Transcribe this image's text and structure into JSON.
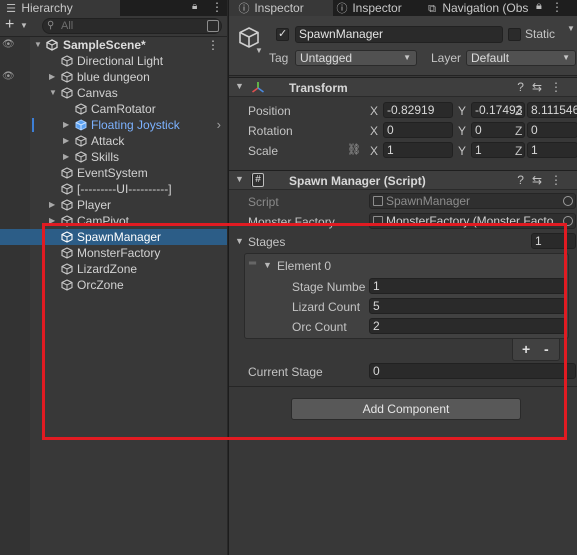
{
  "hierarchy": {
    "tab_label": "Hierarchy",
    "search_placeholder": "All",
    "scene_name": "SampleScene*",
    "items": [
      {
        "label": "Directional Light"
      },
      {
        "label": "blue dungeon"
      },
      {
        "label": "Canvas"
      },
      {
        "label": "CamRotator"
      },
      {
        "label": "Floating Joystick"
      },
      {
        "label": "Attack"
      },
      {
        "label": "Skills"
      },
      {
        "label": "EventSystem"
      },
      {
        "label": "[---------UI----------]"
      },
      {
        "label": "Player"
      },
      {
        "label": "CamPivot"
      },
      {
        "label": "SpawnManager"
      },
      {
        "label": "MonsterFactory"
      },
      {
        "label": "LizardZone"
      },
      {
        "label": "OrcZone"
      }
    ]
  },
  "inspector": {
    "tabs": [
      {
        "label": "Inspector",
        "icon": "info-icon"
      },
      {
        "label": "Inspector",
        "icon": "info-icon"
      },
      {
        "label": "Navigation (Obs",
        "icon": "navigation-icon"
      }
    ],
    "object_name": "SpawnManager",
    "static_label": "Static",
    "tag_label": "Tag",
    "tag_value": "Untagged",
    "layer_label": "Layer",
    "layer_value": "Default",
    "transform": {
      "title": "Transform",
      "position_label": "Position",
      "rotation_label": "Rotation",
      "scale_label": "Scale",
      "position": {
        "x": "-0.82919",
        "y": "-0.17493",
        "z": "8.111546"
      },
      "rotation": {
        "x": "0",
        "y": "0",
        "z": "0"
      },
      "scale": {
        "x": "1",
        "y": "1",
        "z": "1"
      },
      "axis_x": "X",
      "axis_y": "Y",
      "axis_z": "Z"
    },
    "script_component": {
      "title": "Spawn Manager (Script)",
      "script_label": "Script",
      "script_value": "SpawnManager",
      "factory_label": "Monster Factory",
      "factory_value": "MonsterFactory (Monster Facto",
      "stages_label": "Stages",
      "stages_count": "1",
      "element_label": "Element 0",
      "stage_number_label": "Stage Numbe",
      "stage_number_value": "1",
      "lizard_count_label": "Lizard Count",
      "lizard_count_value": "5",
      "orc_count_label": "Orc Count",
      "orc_count_value": "2",
      "plus_label": "+",
      "minus_label": "-",
      "current_stage_label": "Current Stage",
      "current_stage_value": "0"
    },
    "add_component_label": "Add Component"
  },
  "colors": {
    "selection": "#2c5d87",
    "prefab_blue": "#7cb2ff",
    "highlight_box": "#e11b22",
    "panel_bg": "#383838"
  }
}
